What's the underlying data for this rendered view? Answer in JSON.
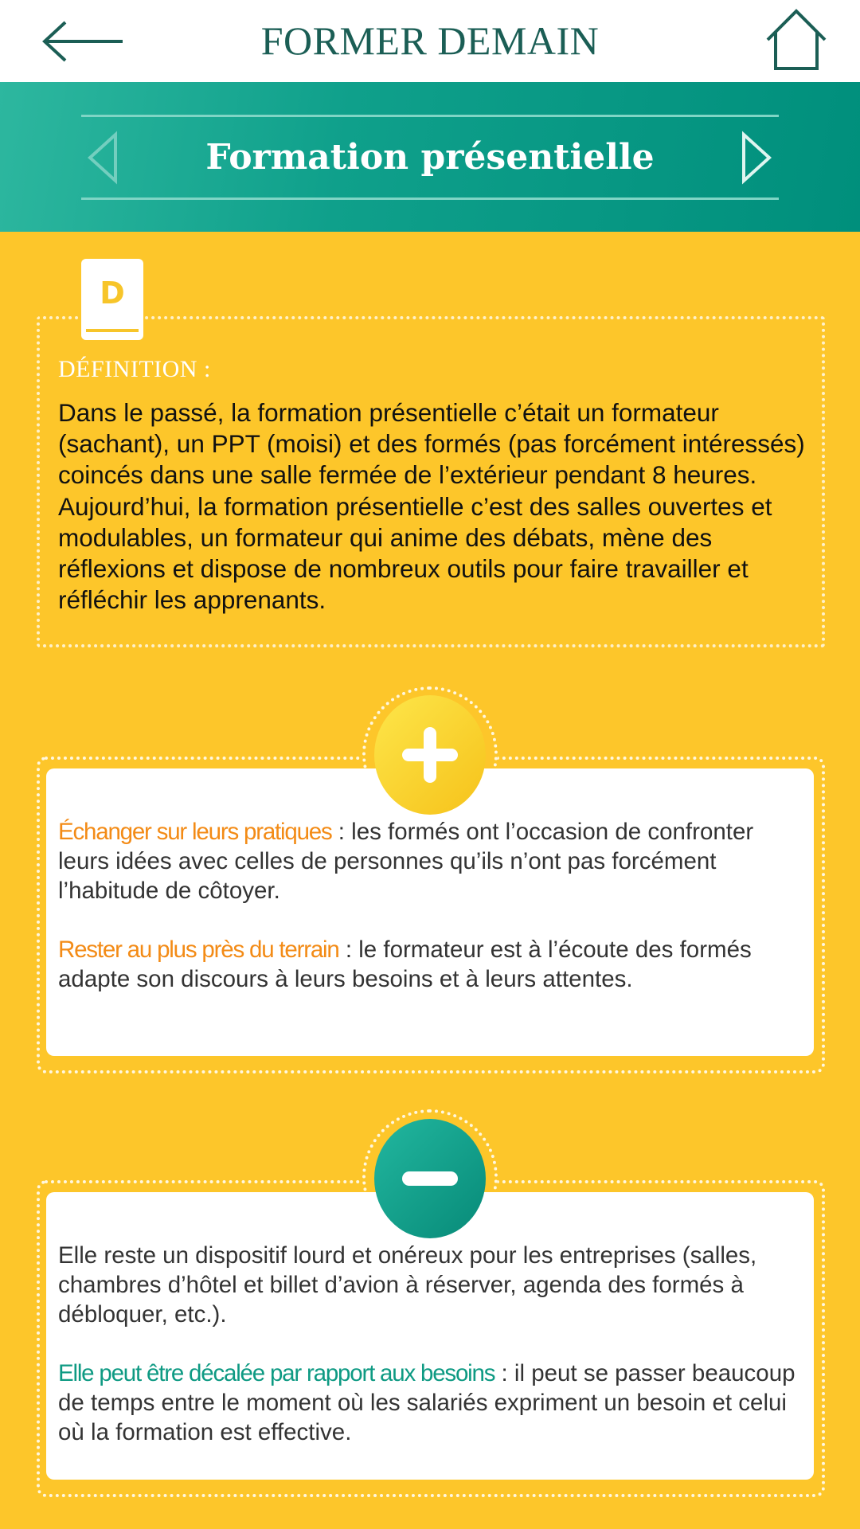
{
  "header": {
    "title": "FORMER DEMAIN",
    "back_icon": "arrow-left-icon",
    "home_icon": "home-icon"
  },
  "banner": {
    "title": "Formation présentielle",
    "prev_icon": "chevron-left-icon",
    "next_icon": "chevron-right-icon"
  },
  "definition": {
    "icon": "dictionary-book-icon",
    "icon_letter": "D",
    "label": "DÉFINITION :",
    "text": "Dans le passé, la formation présentielle c’était un formateur (sachant), un PPT (moisi) et des formés (pas forcément intéressés) coincés dans une salle fermée de l’extérieur pendant 8 heures. Aujourd’hui, la formation présentielle c’est des salles ouvertes et modulables, un formateur qui anime des débats, mène des réflexions et dispose de nombreux outils pour faire travailler et réfléchir les apprenants."
  },
  "pros": {
    "icon": "plus-icon",
    "items": [
      {
        "highlight": "Échanger sur leurs pratiques",
        "text": " :  les formés ont l’occasion de confronter leurs idées avec celles de personnes qu’ils n’ont pas forcément l’habitude de côtoyer."
      },
      {
        "highlight": "Rester au plus près du terrain",
        "text": " :  le formateur est à l’écoute des formés adapte son discours à leurs besoins et à leurs attentes."
      }
    ]
  },
  "cons": {
    "icon": "minus-icon",
    "items": [
      {
        "highlight": "",
        "text": "Elle reste un dispositif lourd et onéreux pour les entreprises (salles, chambres d’hôtel et billet d’avion à réserver, agenda des formés à débloquer, etc.)."
      },
      {
        "highlight": "Elle peut être décalée par rapport aux besoins",
        "text": " :  il peut se passer beaucoup de temps entre le moment où les salariés expriment un besoin et celui où la formation est effective."
      }
    ]
  },
  "colors": {
    "background_yellow": "#fdc62a",
    "teal": "#0fa08b",
    "header_text": "#1b5e55",
    "pro_highlight": "#f38b16",
    "con_highlight": "#0e9a83"
  }
}
